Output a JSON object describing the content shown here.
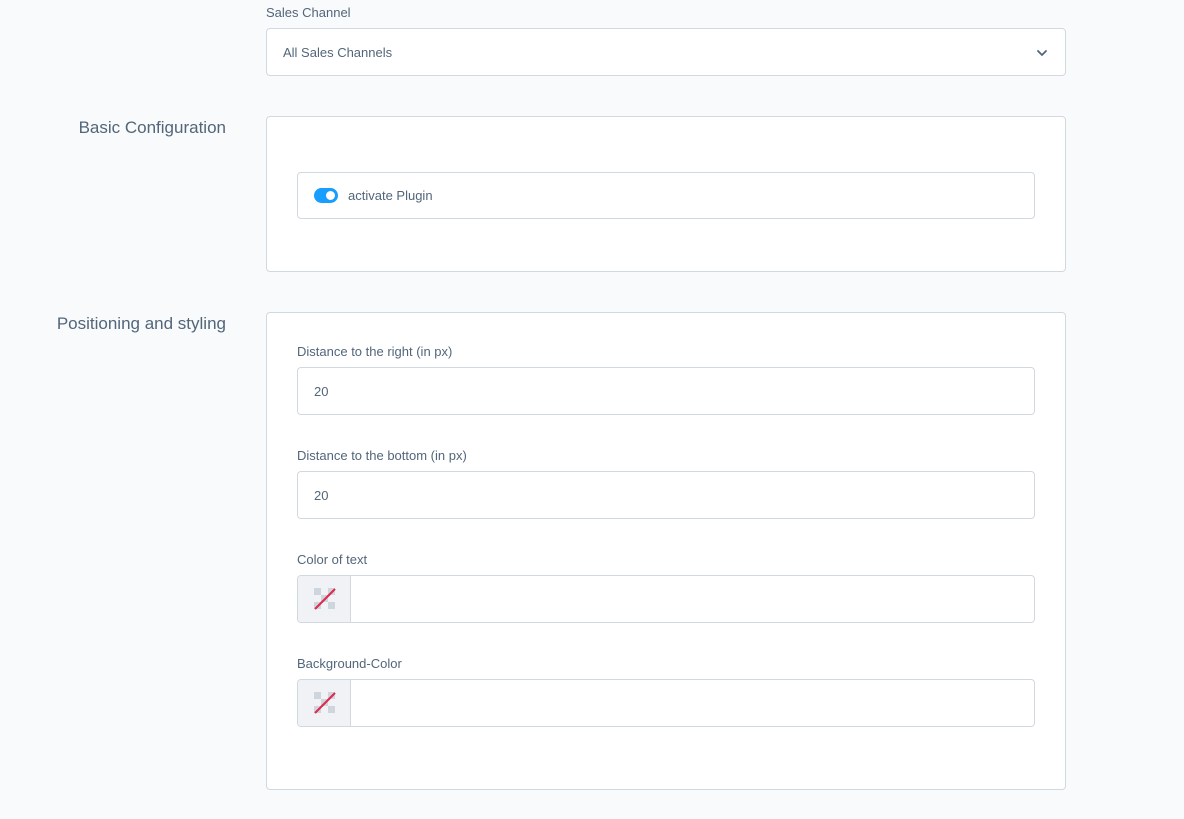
{
  "sales_channel": {
    "label": "Sales Channel",
    "selected": "All Sales Channels",
    "icon": "chevron-down-icon"
  },
  "basic_configuration": {
    "title": "Basic Configuration",
    "activate_plugin": {
      "label": "activate Plugin",
      "enabled": true
    }
  },
  "positioning": {
    "title": "Positioning and styling",
    "distance_right": {
      "label": "Distance to the right (in px)",
      "value": "20"
    },
    "distance_bottom": {
      "label": "Distance to the bottom (in px)",
      "value": "20"
    },
    "text_color": {
      "label": "Color of text",
      "value": "",
      "icon": "no-color-icon"
    },
    "background_color": {
      "label": "Background-Color",
      "value": "",
      "icon": "no-color-icon"
    }
  },
  "colors": {
    "accent": "#189eff",
    "border": "#d1d9e0",
    "text": "#52667a",
    "empty_swatch_slash": "#de294c"
  }
}
